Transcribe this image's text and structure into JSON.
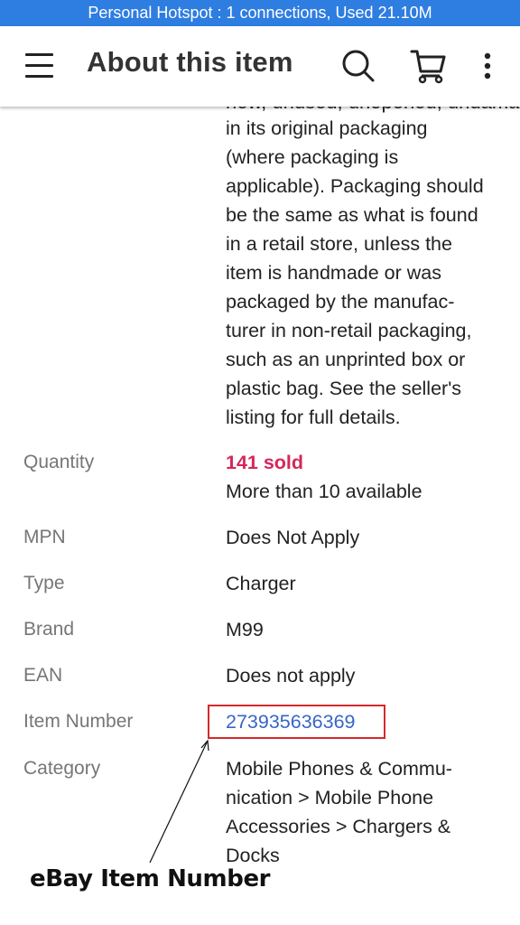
{
  "status_bar": {
    "text": "Personal Hotspot : 1 connections, Used 21.10M",
    "background": "#2e7de1"
  },
  "app_bar": {
    "title": "About this item",
    "icons": [
      "menu-icon",
      "search-icon",
      "cart-icon",
      "more-vertical-icon"
    ]
  },
  "condition_description": {
    "partial_top_line": "new, unused, unopened, undamaged item",
    "lines": [
      "in its original packaging",
      "(where packaging is",
      "applicable). Packaging should",
      "be the same as what is found",
      "in a retail store, unless the",
      "item is handmade or was",
      "packaged by the manufac-",
      "turer in non-retail packaging,",
      "such as an unprinted box or",
      "plastic bag. See the seller's",
      "listing for full details."
    ]
  },
  "specifics": {
    "quantity": {
      "label": "Quantity",
      "sold": "141 sold",
      "available": "More than 10 available",
      "sold_color": "#d6275a"
    },
    "mpn": {
      "label": "MPN",
      "value": "Does Not Apply"
    },
    "type": {
      "label": "Type",
      "value": "Charger"
    },
    "brand": {
      "label": "Brand",
      "value": "M99"
    },
    "ean": {
      "label": "EAN",
      "value": "Does not apply"
    },
    "item_number": {
      "label": "Item Number",
      "value": "273935636369",
      "link_color": "#3665c9"
    },
    "category": {
      "label": "Category",
      "lines": [
        "Mobile Phones & Commu-",
        "nication > Mobile Phone",
        "Accessories > Chargers &",
        "Docks"
      ]
    }
  },
  "annotation": {
    "text": "eBay Item Number",
    "box_color": "#d42a2a"
  }
}
